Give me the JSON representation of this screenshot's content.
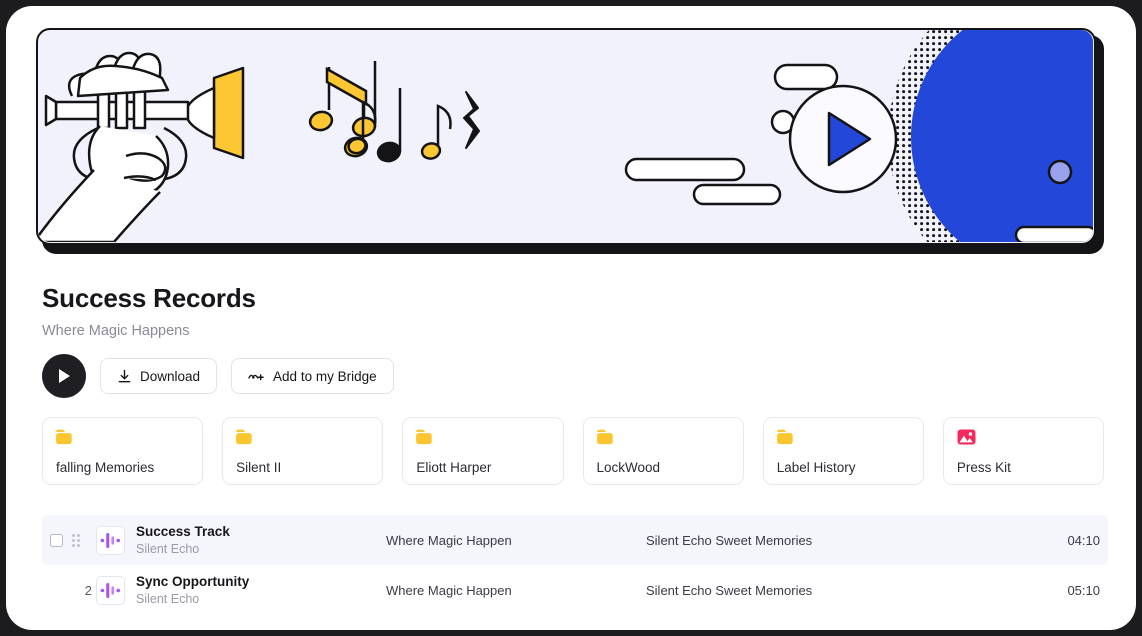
{
  "header": {
    "title": "Success Records",
    "subtitle": "Where Magic Happens"
  },
  "banner": {
    "alt": "illustration-hands-playing-trumpet-with-music-notes-and-vinyl-record",
    "background_color": "#f2f2fd",
    "record_color": "#2347d9",
    "note_color": "#fcc733",
    "outline_color": "#141417"
  },
  "toolbar": {
    "play_label": "play",
    "download_label": "Download",
    "add_bridge_label": "Add to my Bridge"
  },
  "folders": [
    {
      "label": "falling Memories",
      "icon": "folder-icon",
      "color": "#fbc52f"
    },
    {
      "label": "Silent II",
      "icon": "folder-icon",
      "color": "#fbc52f"
    },
    {
      "label": "Eliott Harper",
      "icon": "folder-icon",
      "color": "#fbc52f"
    },
    {
      "label": "LockWood",
      "icon": "folder-icon",
      "color": "#fbc52f"
    },
    {
      "label": "Label History",
      "icon": "folder-icon",
      "color": "#fbc52f"
    },
    {
      "label": "Press Kit",
      "icon": "image-icon",
      "color": "#f5285c"
    }
  ],
  "tracks": [
    {
      "index": "",
      "selected": true,
      "title": "Success Track",
      "artist": "Silent Echo",
      "album": "Where Magic Happen",
      "description": "Silent Echo Sweet Memories",
      "duration": "04:10"
    },
    {
      "index": "2",
      "selected": false,
      "title": "Sync Opportunity",
      "artist": "Silent Echo",
      "album": "Where Magic Happen",
      "description": "Silent Echo Sweet Memories",
      "duration": "05:10"
    }
  ]
}
